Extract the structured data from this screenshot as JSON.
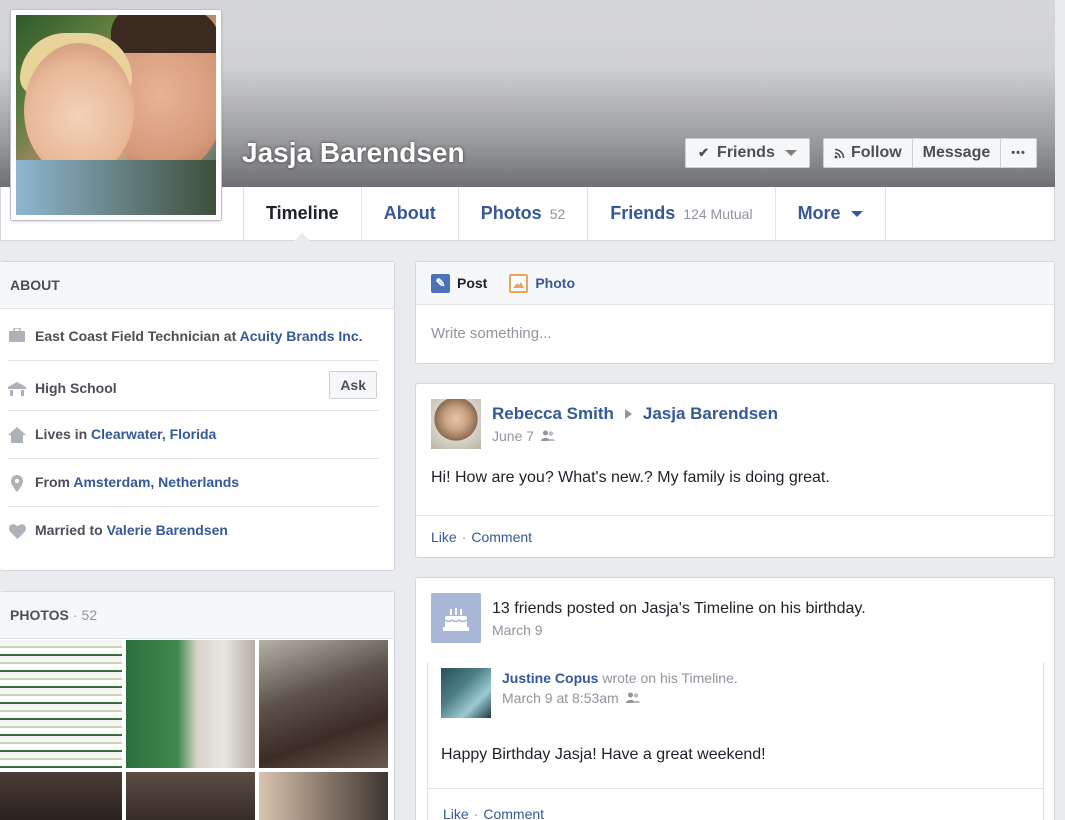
{
  "profile": {
    "name": "Jasja Barendsen"
  },
  "cover_actions": {
    "friends_label": "Friends",
    "follow_label": "Follow",
    "message_label": "Message",
    "more_label": "•••"
  },
  "tabs": [
    {
      "label": "Timeline",
      "count": ""
    },
    {
      "label": "About",
      "count": ""
    },
    {
      "label": "Photos",
      "count": "52"
    },
    {
      "label": "Friends",
      "count": "124 Mutual"
    },
    {
      "label": "More",
      "count": ""
    }
  ],
  "about": {
    "header": "ABOUT",
    "work_prefix": "East Coast Field Technician at ",
    "work_link": "Acuity Brands Inc.",
    "education": "High School",
    "ask_label": "Ask",
    "lives_prefix": "Lives in ",
    "lives_link": "Clearwater, Florida",
    "from_prefix": "From ",
    "from_link": "Amsterdam, Netherlands",
    "married_prefix": "Married to ",
    "married_link": "Valerie Barendsen"
  },
  "photos": {
    "header": "PHOTOS",
    "separator": "·",
    "count": "52"
  },
  "composer": {
    "post_label": "Post",
    "photo_label": "Photo",
    "placeholder": "Write something..."
  },
  "post1": {
    "author": "Rebecca Smith",
    "target": "Jasja Barendsen",
    "date": "June 7",
    "body": "Hi! How are you? What's new.? My family is doing great.",
    "like": "Like",
    "dot": "·",
    "comment": "Comment"
  },
  "post2": {
    "title": "13 friends posted on Jasja's Timeline on his birthday.",
    "date": "March 9",
    "inner_author": "Justine Copus",
    "inner_wrote": " wrote on his Timeline.",
    "inner_date": "March 9 at 8:53am",
    "inner_body": "Happy Birthday Jasja! Have a great weekend!",
    "like": "Like",
    "dot": "·",
    "comment": "Comment"
  },
  "colors": {
    "link": "#365899",
    "muted": "#90949c",
    "background": "#e9ebee"
  }
}
